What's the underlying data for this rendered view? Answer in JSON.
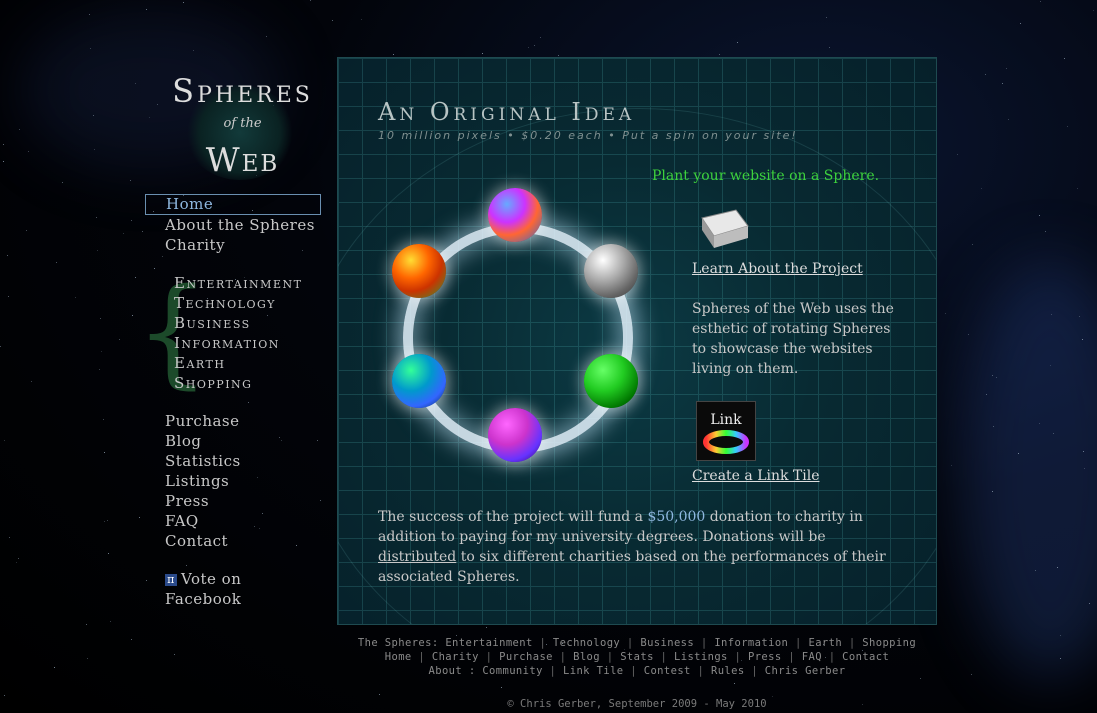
{
  "logo": {
    "line1": "Spheres",
    "line2": "of the",
    "line3": "Web"
  },
  "nav": {
    "main": [
      "Home",
      "About the Spheres",
      "Charity"
    ],
    "spheres": [
      "Entertainment",
      "Technology",
      "Business",
      "Information",
      "Earth",
      "Shopping"
    ],
    "other": [
      "Purchase",
      "Blog",
      "Statistics",
      "Listings",
      "Press",
      "FAQ",
      "Contact"
    ],
    "vote_line1": "Vote on",
    "vote_line2": "Facebook",
    "active": "Home"
  },
  "content": {
    "title": "An Original Idea",
    "subtitle": "10 million pixels • $0.20 each • Put a spin on your site!",
    "plant": "Plant your website on a Sphere.",
    "learn_link": "Learn About the Project",
    "description": "Spheres of the Web uses the esthetic of rotating Spheres to showcase the websites living on them.",
    "tile_label": "Link",
    "tile_link": "Create a Link Tile",
    "funding_before": "The success of the project will fund a ",
    "funding_amount": "$50,000",
    "funding_middle": " donation to charity in addition to paying for my university degrees. Donations will be ",
    "funding_distributed": "distributed",
    "funding_after": " to six different charities based on the performances of their associated Spheres."
  },
  "footer": {
    "line1_prefix": "The Spheres:",
    "line1": [
      "Entertainment",
      "Technology",
      "Business",
      "Information",
      "Earth",
      "Shopping"
    ],
    "line2": [
      "Home",
      "Charity",
      "Purchase",
      "Blog",
      "Stats",
      "Listings",
      "Press",
      "FAQ",
      "Contact"
    ],
    "line3_prefix": "About :",
    "line3": [
      "Community",
      "Link Tile",
      "Contest",
      "Rules",
      "Chris Gerber"
    ],
    "copyright": "© Chris Gerber, September 2009 - May 2010"
  },
  "colors": {
    "accent_green": "#3dd23d",
    "accent_blue": "#8fb8e0",
    "panel_bg": "#082a32"
  }
}
